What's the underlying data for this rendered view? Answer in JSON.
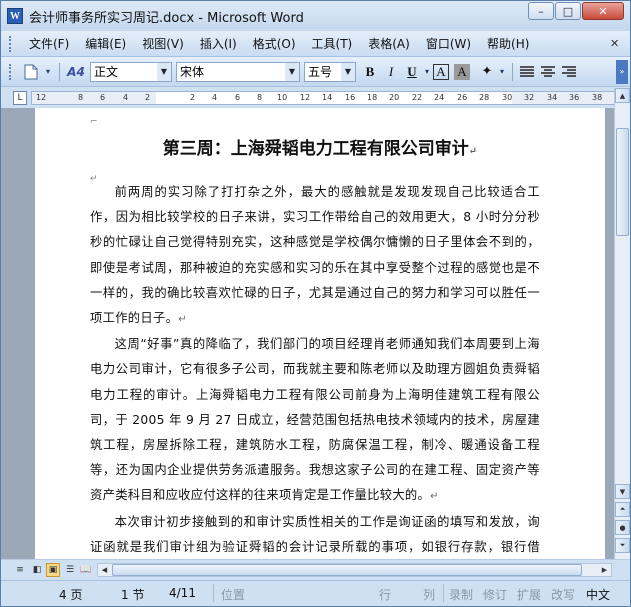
{
  "window": {
    "title": "会计师事务所实习周记.docx - Microsoft Word",
    "app_icon": "W",
    "controls": {
      "minimize": "–",
      "maximize": "□",
      "close": "✕"
    }
  },
  "menu": {
    "items": [
      "文件(F)",
      "编辑(E)",
      "视图(V)",
      "插入(I)",
      "格式(O)",
      "工具(T)",
      "表格(A)",
      "窗口(W)",
      "帮助(H)"
    ]
  },
  "toolbar": {
    "style_value": "正文",
    "font_value": "宋体",
    "size_value": "五号",
    "bold": "B",
    "italic": "I",
    "underline": "U",
    "char_border": "A",
    "char_shading": "A",
    "styles_icon": "A4",
    "highlight": "✦"
  },
  "ruler": {
    "numbers": [
      "12",
      "8",
      "6",
      "4",
      "2",
      "2",
      "4",
      "6",
      "8",
      "10",
      "12",
      "14",
      "16",
      "18",
      "20",
      "22",
      "24",
      "26",
      "28",
      "30",
      "32",
      "34",
      "36",
      "38"
    ]
  },
  "document": {
    "title": "第三周：上海舜韬电力工程有限公司审计",
    "paragraphs": [
      "前两周的实习除了打打杂之外，最大的感触就是发现发现自己比较适合工作，因为相比较学校的日子来讲，实习工作带给自己的效用更大，8 小时分分秒秒的忙碌让自己觉得特别充实，这种感觉是学校偶尔慵懒的日子里体会不到的，即使是考试周，那种被迫的充实感和实习的乐在其中享受整个过程的感觉也是不一样的，我的确比较喜欢忙碌的日子，尤其是通过自己的努力和学习可以胜任一项工作的日子。",
      "这周“好事”真的降临了，我们部门的项目经理肖老师通知我们本周要到上海电力公司审计，它有很多子公司，而我就主要和陈老师以及助理方圆姐负责舜韬电力工程的审计。上海舜韬电力工程有限公司前身为上海明佳建筑工程有限公司，于 2005 年 9 月 27 日成立，经营范围包括热电技术领域内的技术，房屋建筑工程，房屋拆除工程，建筑防水工程，防腐保温工程，制冷、暖通设备工程等，还为国内企业提供劳务派遣服务。我想这家子公司的在建工程、固定资产等资产类科目和应收应付这样的往来项肯定是工作量比较大的。",
      "本次审计初步接触到的和审计实质性相关的工作是询证函的填写和发放，询证函就是我们审计组为验证舜韬的会计记录所载的事项，如银行存款，银行借款，"
    ]
  },
  "status": {
    "page": "4 页",
    "section": "1 节",
    "page_of": "4/11",
    "position_label": "位置",
    "line_label": "行",
    "col_label": "列",
    "rec": "录制",
    "trk": "修订",
    "ext": "扩展",
    "ovr": "改写",
    "lang": "中文"
  }
}
